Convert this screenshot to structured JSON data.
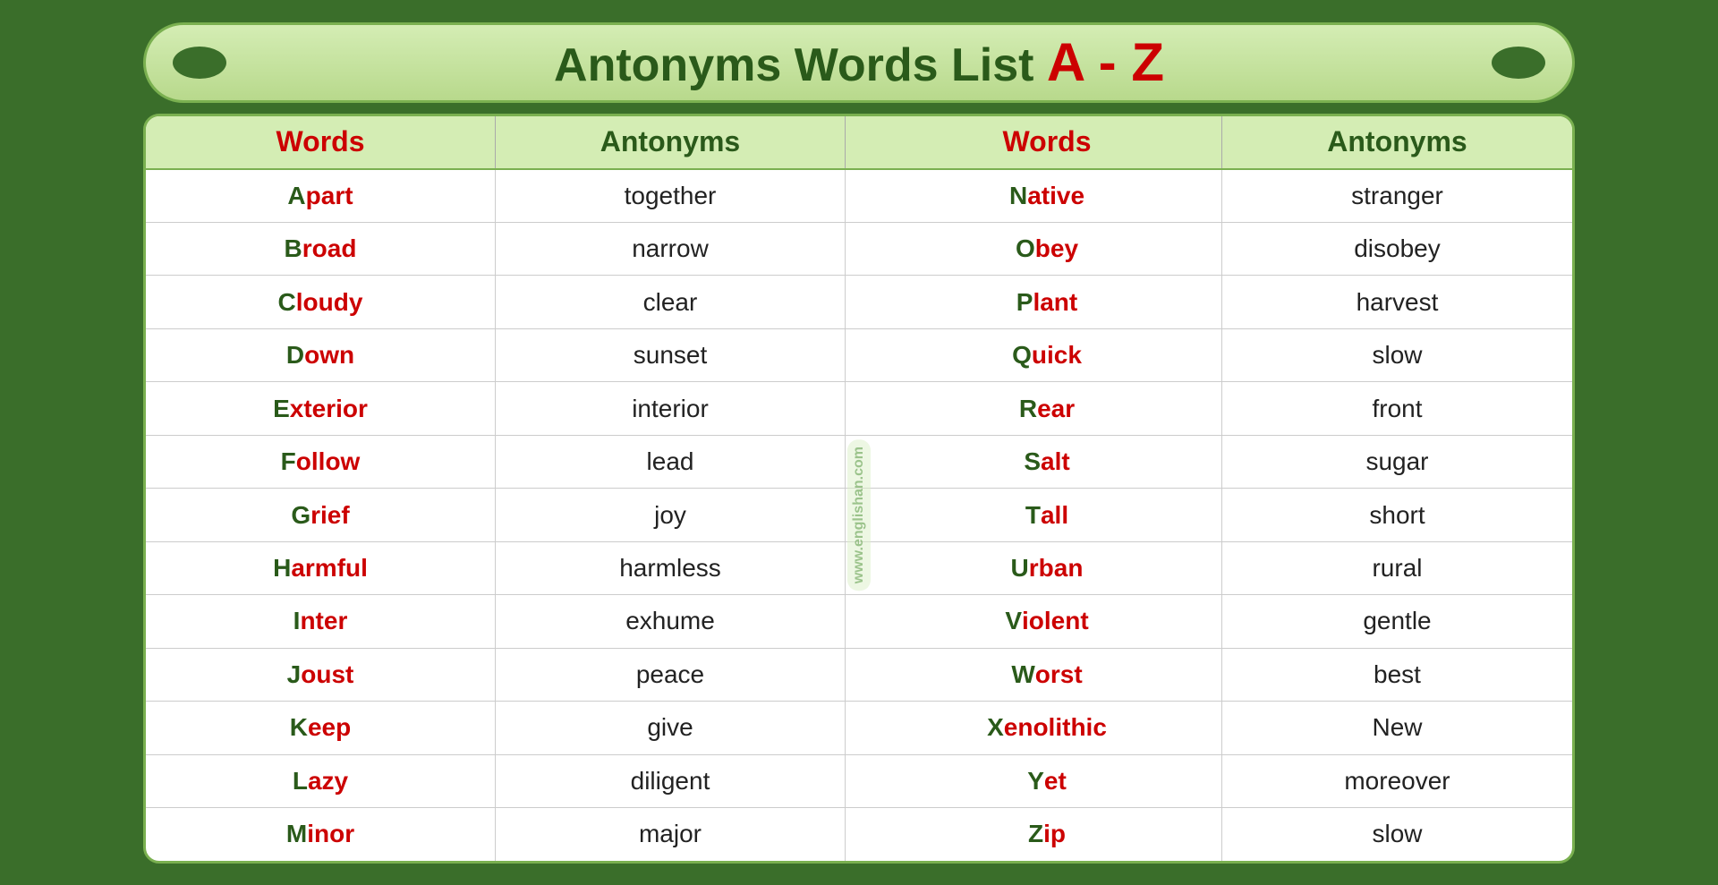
{
  "header": {
    "title_main": "Antonyms Words  List ",
    "title_az": "A - Z",
    "oval_left": "●",
    "oval_right": "●"
  },
  "columns": {
    "words_label": "Words",
    "antonyms_label": "Antonyms"
  },
  "rows": [
    {
      "word_left": "Apart",
      "antonym_left": "together",
      "word_right": "Native",
      "antonym_right": "stranger"
    },
    {
      "word_left": "Broad",
      "antonym_left": "narrow",
      "word_right": "Obey",
      "antonym_right": "disobey"
    },
    {
      "word_left": "Cloudy",
      "antonym_left": "clear",
      "word_right": "Plant",
      "antonym_right": "harvest"
    },
    {
      "word_left": "Down",
      "antonym_left": "sunset",
      "word_right": "Quick",
      "antonym_right": "slow"
    },
    {
      "word_left": "Exterior",
      "antonym_left": "interior",
      "word_right": "Rear",
      "antonym_right": "front"
    },
    {
      "word_left": "Follow",
      "antonym_left": "lead",
      "word_right": "Salt",
      "antonym_right": "sugar"
    },
    {
      "word_left": "Grief",
      "antonym_left": "joy",
      "word_right": "Tall",
      "antonym_right": "short"
    },
    {
      "word_left": "Harmful",
      "antonym_left": "harmless",
      "word_right": "Urban",
      "antonym_right": "rural"
    },
    {
      "word_left": "Inter",
      "antonym_left": "exhume",
      "word_right": "Violent",
      "antonym_right": "gentle"
    },
    {
      "word_left": "Joust",
      "antonym_left": "peace",
      "word_right": "Worst",
      "antonym_right": "best"
    },
    {
      "word_left": "Keep",
      "antonym_left": "give",
      "word_right": "Xenolithic",
      "antonym_right": "New"
    },
    {
      "word_left": "Lazy",
      "antonym_left": "diligent",
      "word_right": "Yet",
      "antonym_right": "moreover"
    },
    {
      "word_left": "Minor",
      "antonym_left": "major",
      "word_right": "Zip",
      "antonym_right": "slow"
    }
  ],
  "watermark": "www.englishan.com"
}
